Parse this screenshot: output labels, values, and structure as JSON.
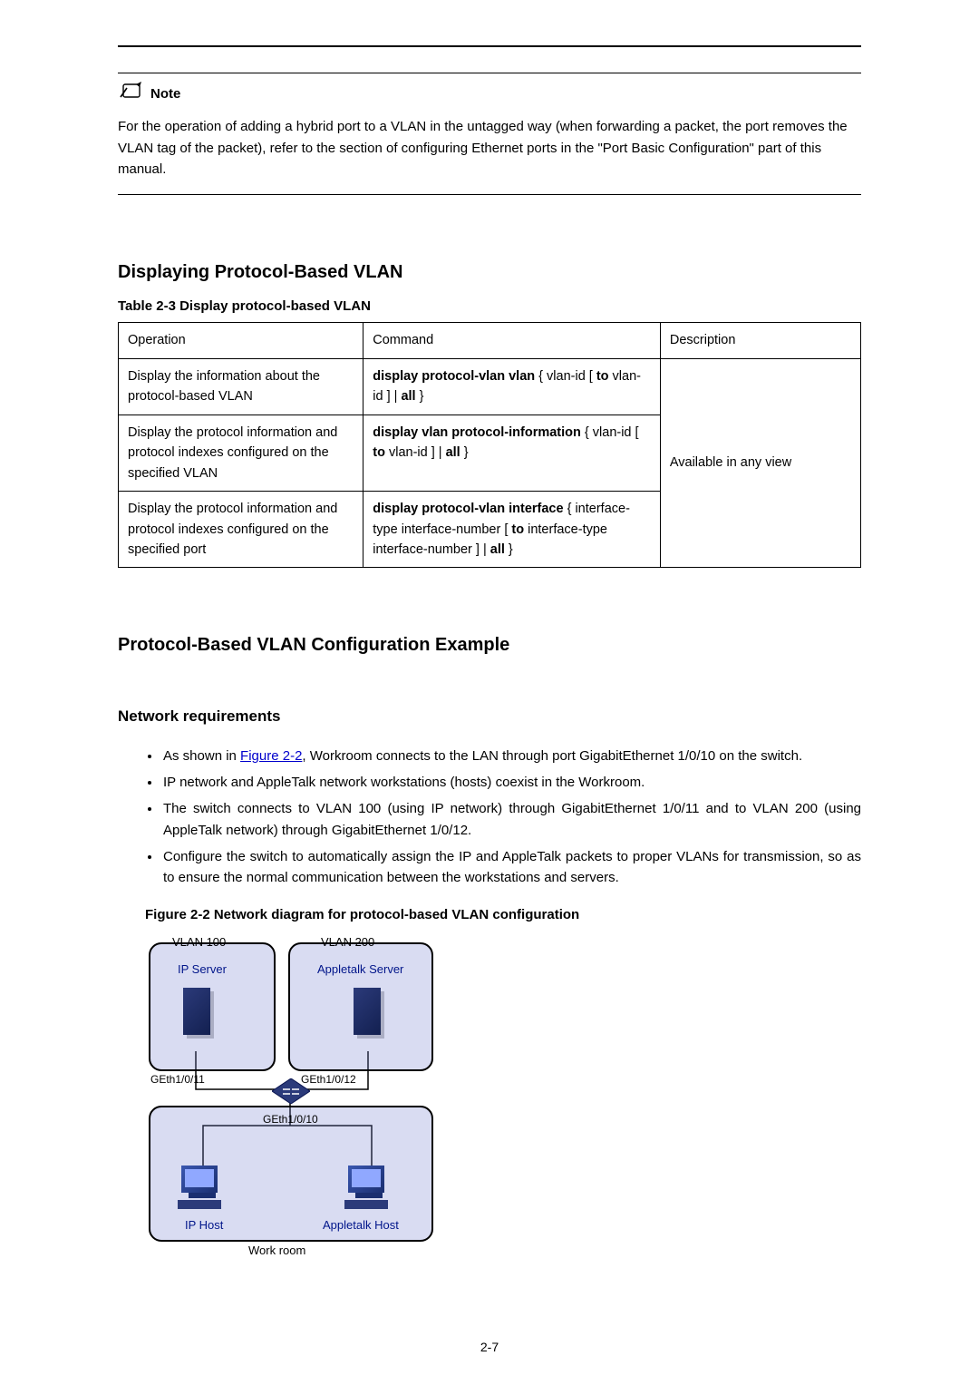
{
  "note": {
    "label": "Note",
    "text": "For the operation of adding a hybrid port to a VLAN in the untagged way (when forwarding a packet, the port removes the VLAN tag of the packet), refer to the section of configuring Ethernet ports in the \"Port Basic Configuration\" part of this manual."
  },
  "section_display": {
    "heading": "Displaying Protocol-Based VLAN",
    "table_caption": "Table 2-3 Display protocol-based VLAN",
    "headers": [
      "Operation",
      "Command",
      "Description"
    ],
    "rows": [
      {
        "op": "Display the information about the protocol-based VLAN",
        "cmd_parts": [
          "display protocol-vlan vlan ",
          "{ vlan-id [ ",
          "to",
          " vlan-id ] | ",
          "all ",
          "}"
        ],
        "desc": "Available in any view"
      },
      {
        "op": "Display the protocol information and protocol indexes configured on the specified VLAN",
        "cmd_parts": [
          "display vlan protocol-information ",
          "{ vlan-id [ ",
          "to",
          " vlan-id ] | ",
          "all ",
          "}"
        ],
        "desc": ""
      },
      {
        "op": "Display the protocol information and protocol indexes configured on the specified port",
        "cmd_parts": [
          "display protocol-vlan interface ",
          "{ interface-type interface-number [ ",
          "to",
          " interface-type interface-number ] | ",
          "all ",
          "}"
        ],
        "desc": ""
      }
    ]
  },
  "section_example": {
    "heading": "Protocol-Based VLAN Configuration Example",
    "sub_heading": "Network requirements",
    "bullets_pre_link": "As shown in ",
    "link_text": "Figure 2-2",
    "bullets_post_link": ", Workroom connects to the LAN through port GigabitEthernet 1/0/10 on the switch.",
    "bullets": [
      "IP network and AppleTalk network workstations (hosts) coexist in the Workroom.",
      "The switch connects to VLAN 100 (using IP network) through GigabitEthernet 1/0/11 and to VLAN 200 (using AppleTalk network) through GigabitEthernet 1/0/12.",
      "Configure the switch to automatically assign the IP and AppleTalk packets to proper VLANs for transmission, so as to ensure the normal communication between the workstations and servers."
    ],
    "figure_caption": "Figure 2-2 Network diagram for protocol-based VLAN configuration",
    "diagram": {
      "vlan100": "VLAN 100",
      "vlan200": "VLAN 200",
      "ip_server": "IP Server",
      "at_server": "Appletalk Server",
      "ge11": "GEth1/0/11",
      "ge12": "GEth1/0/12",
      "ge10": "GEth1/0/10",
      "ip_host": "IP Host",
      "at_host": "Appletalk Host",
      "workroom": "Work room"
    }
  },
  "page_number": "2-7"
}
